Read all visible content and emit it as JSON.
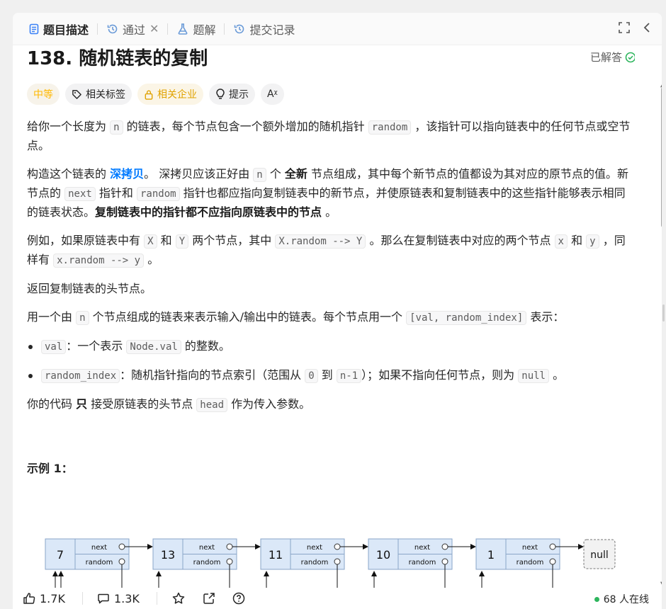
{
  "tabs": [
    {
      "label": "题目描述",
      "icon": "description-icon",
      "active": true
    },
    {
      "label": "通过",
      "icon": "history-icon",
      "active": false,
      "closable": true
    },
    {
      "label": "题解",
      "icon": "flask-icon",
      "active": false
    },
    {
      "label": "提交记录",
      "icon": "history-icon",
      "active": false
    }
  ],
  "problem": {
    "title": "138. 随机链表的复制",
    "status": "已解答"
  },
  "tags": {
    "difficulty": "中等",
    "related_tags": "相关标签",
    "related_companies": "相关企业",
    "hint": "提示",
    "translate": "Aᵡ"
  },
  "description": {
    "p1": [
      "给你一个长度为 ",
      "n",
      " 的链表，每个节点包含一个额外增加的随机指针 ",
      "random",
      " ，该指针可以指向链表中的任何节点或空节点。"
    ],
    "p2": [
      "构造这个链表的 ",
      "深拷贝",
      "。 深拷贝应该正好由 ",
      "n",
      " 个 ",
      "全新",
      " 节点组成，其中每个新节点的值都设为其对应的原节点的值。新节点的 ",
      "next",
      " 指针和 ",
      "random",
      " 指针也都应指向复制链表中的新节点，并使原链表和复制链表中的这些指针能够表示相同的链表状态。",
      "复制链表中的指针都不应指向原链表中的节点",
      " 。"
    ],
    "p3": [
      "例如，如果原链表中有 ",
      "X",
      " 和 ",
      "Y",
      " 两个节点，其中 ",
      "X.random --> Y",
      " 。那么在复制链表中对应的两个节点 ",
      "x",
      " 和 ",
      "y",
      " ，同样有 ",
      "x.random --> y",
      " 。"
    ],
    "p4": "返回复制链表的头节点。",
    "p5": [
      "用一个由 ",
      "n",
      " 个节点组成的链表来表示输入/输出中的链表。每个节点用一个 ",
      "[val, random_index]",
      " 表示："
    ],
    "li1": [
      "val",
      "：一个表示 ",
      "Node.val",
      " 的整数。"
    ],
    "li2": [
      "random_index",
      "：随机指针指向的节点索引（范围从 ",
      "0",
      " 到 ",
      "n-1",
      "）；如果不指向任何节点，则为  ",
      "null",
      " 。"
    ],
    "p6": [
      "你的代码 ",
      "只",
      " 接受原链表的头节点 ",
      "head",
      " 作为传入参数。"
    ],
    "example_heading": "示例 1："
  },
  "diagram": {
    "nodes": [
      "7",
      "13",
      "11",
      "10",
      "1"
    ],
    "next_label": "next",
    "random_label": "random",
    "null_label": "null"
  },
  "footer": {
    "likes": "1.7K",
    "comments": "1.3K",
    "online": "68 人在线"
  },
  "colors": {
    "accent_blue": "#007aff",
    "difficulty_medium": "#ffb800",
    "solved_green": "#2db55d",
    "node_fill": "#dbe8f8"
  }
}
